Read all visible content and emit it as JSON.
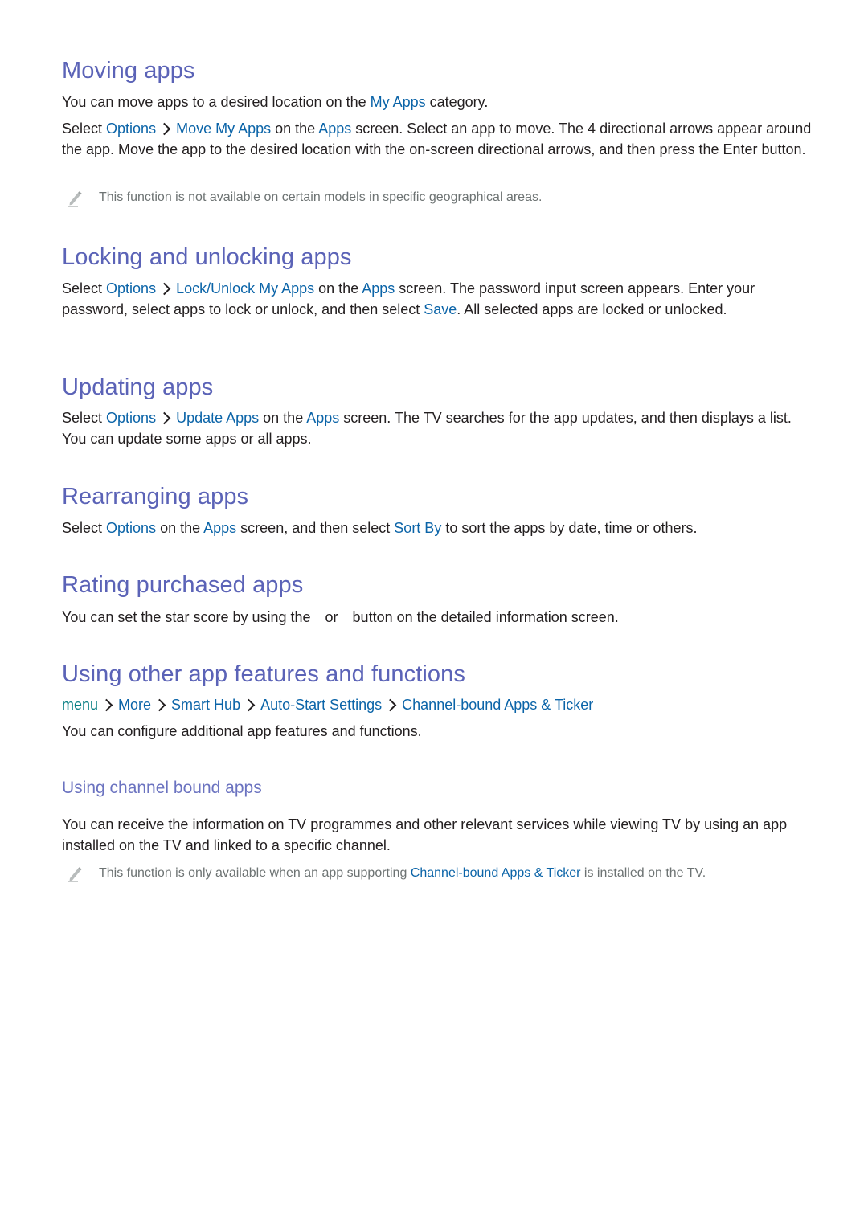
{
  "sections": {
    "moving": {
      "title": "Moving apps",
      "p1": {
        "t1": "You can move apps to a desired location on the ",
        "link1": "My Apps",
        "t2": " category."
      },
      "p2": {
        "t1": "Select ",
        "link1": "Options",
        "link2": "Move My Apps",
        "t2": " on the ",
        "link3": "Apps",
        "t3": " screen. Select an app to move. The 4 directional arrows appear around the app. Move the app to the desired location with the on-screen directional arrows, and then press the Enter button."
      },
      "note": "This function is not available on certain models in specific geographical areas."
    },
    "locking": {
      "title": "Locking and unlocking apps",
      "p1": {
        "t1": "Select ",
        "link1": "Options",
        "link2": "Lock/Unlock My Apps",
        "t2": " on the ",
        "link3": "Apps",
        "t3": " screen. The password input screen appears. Enter your password, select apps to lock or unlock, and then select ",
        "link4": "Save",
        "t4": ". All selected apps are locked or unlocked."
      }
    },
    "updating": {
      "title": "Updating apps",
      "p1": {
        "t1": "Select ",
        "link1": "Options",
        "link2": "Update Apps",
        "t2": " on the ",
        "link3": "Apps",
        "t3": " screen. The TV searches for the app updates, and then displays a list. You can update some apps or all apps."
      }
    },
    "rearranging": {
      "title": "Rearranging apps",
      "p1": {
        "t1": "Select ",
        "link1": "Options",
        "t2": " on the ",
        "link2": "Apps",
        "t3": " screen, and then select ",
        "link3": "Sort By",
        "t4": " to sort the apps by date, time or others."
      }
    },
    "rating": {
      "title": "Rating purchased apps",
      "p1": {
        "t1": "You can set the star score by using the",
        "t2": "or",
        "t3": "button on the detailed information screen."
      }
    },
    "other": {
      "title": "Using other app features and functions",
      "path": [
        "menu",
        "More",
        "Smart Hub",
        "Auto-Start Settings",
        "Channel-bound Apps & Ticker"
      ],
      "p1": "You can configure additional app features and functions.",
      "sub": {
        "title": "Using channel bound apps",
        "p1": "You can receive the information on TV programmes and other relevant services while viewing TV by using an app installed on the TV and linked to a specific channel.",
        "note": {
          "t1": "This function is only available when an app supporting ",
          "link1": "Channel-bound Apps & Ticker",
          "t2": " is installed on the TV."
        }
      }
    }
  },
  "colors": {
    "heading": "#5b63b7",
    "subheading": "#6b73c0",
    "link": "#0b64a8",
    "menu_link": "#0a7f84",
    "body_text": "#231f20",
    "note_text": "#6d7373"
  }
}
